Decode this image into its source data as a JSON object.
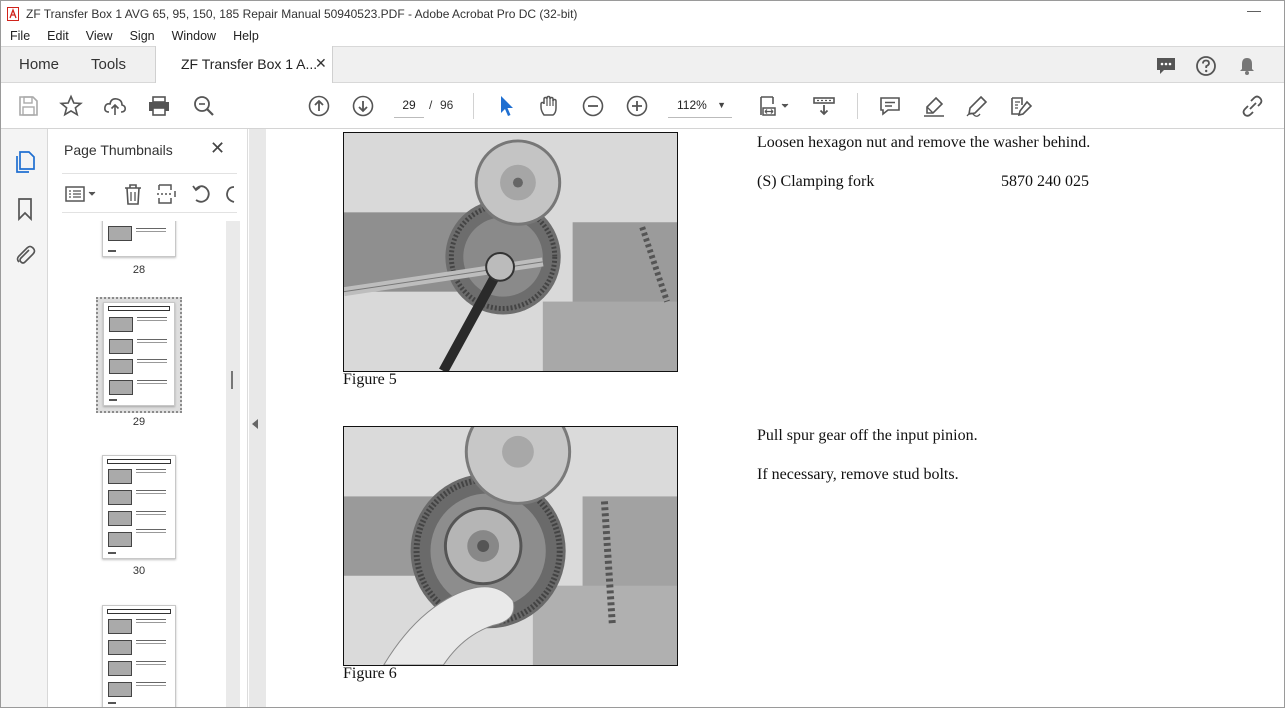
{
  "window": {
    "title": "ZF Transfer Box 1 AVG 65, 95, 150, 185 Repair Manual 50940523.PDF - Adobe Acrobat Pro DC (32-bit)",
    "minimize": "—"
  },
  "menu": [
    "File",
    "Edit",
    "View",
    "Sign",
    "Window",
    "Help"
  ],
  "tabs": {
    "home": "Home",
    "tools": "Tools",
    "doc": "ZF Transfer Box 1 A...",
    "doc_close": "✕"
  },
  "toolbar": {
    "current_page": "29",
    "page_sep": "/",
    "total_pages": "96",
    "zoom": "112%",
    "zoom_caret": "▼"
  },
  "thumbnails": {
    "title": "Page Thumbnails",
    "close": "✕",
    "pages": [
      {
        "label": "28"
      },
      {
        "label": "29",
        "selected": true
      },
      {
        "label": "30"
      },
      {
        "label": ""
      }
    ]
  },
  "document": {
    "fig5_caption": "Figure 5",
    "fig6_caption": "Figure 6",
    "step1_text": "Loosen hexagon nut and remove the washer behind.",
    "tool_name": "(S) Clamping fork",
    "tool_number": "5870 240 025",
    "step2_text": "Pull spur gear off the input pinion.",
    "step3_text": "If necessary, remove stud bolts."
  },
  "colors": {
    "accent_blue": "#1f6fd1",
    "acrobat_red": "#d0231b",
    "pane_bg": "#f4f4f4",
    "doc_bg": "#e8e8e8"
  },
  "icons": [
    "acrobat-icon",
    "comment-bubble-icon",
    "help-icon",
    "bell-icon",
    "save-icon",
    "star-icon",
    "upload-icon",
    "print-icon",
    "zoom-search-icon",
    "page-up-icon",
    "page-down-icon",
    "select-pointer-icon",
    "hand-icon",
    "zoom-out-icon",
    "zoom-in-icon",
    "page-fit-icon",
    "scroll-mode-icon",
    "comment-icon",
    "highlight-icon",
    "sign-icon",
    "edit-pdf-icon",
    "share-link-icon",
    "pages-icon",
    "bookmark-icon",
    "attachment-icon",
    "options-icon",
    "trash-icon",
    "insert-page-icon",
    "rotate-icon"
  ]
}
